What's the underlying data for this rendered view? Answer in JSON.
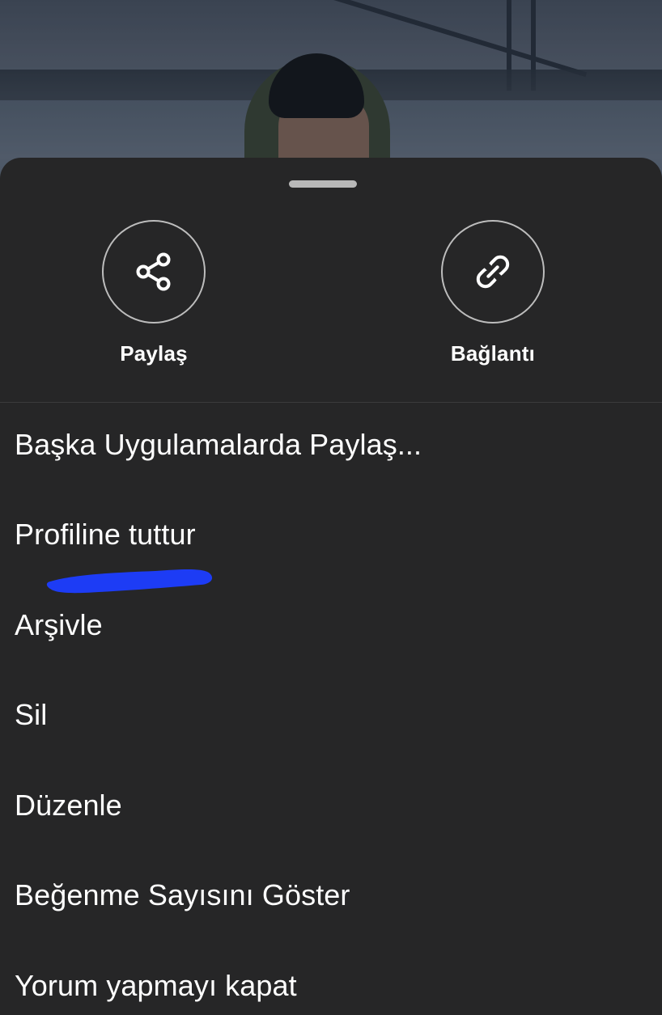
{
  "actions": {
    "share": {
      "label": "Paylaş",
      "icon": "share-icon"
    },
    "link": {
      "label": "Bağlantı",
      "icon": "link-icon"
    }
  },
  "menu": {
    "items": [
      {
        "label": "Başka Uygulamalarda Paylaş..."
      },
      {
        "label": "Profiline tuttur"
      },
      {
        "label": "Arşivle"
      },
      {
        "label": "Sil"
      },
      {
        "label": "Düzenle"
      },
      {
        "label": "Beğenme Sayısını Göster"
      },
      {
        "label": "Yorum yapmayı kapat"
      }
    ]
  },
  "colors": {
    "sheet_background": "#262627",
    "text": "#ffffff",
    "icon_border": "#bdbdbd",
    "highlight_scribble": "#1d3cf5"
  }
}
